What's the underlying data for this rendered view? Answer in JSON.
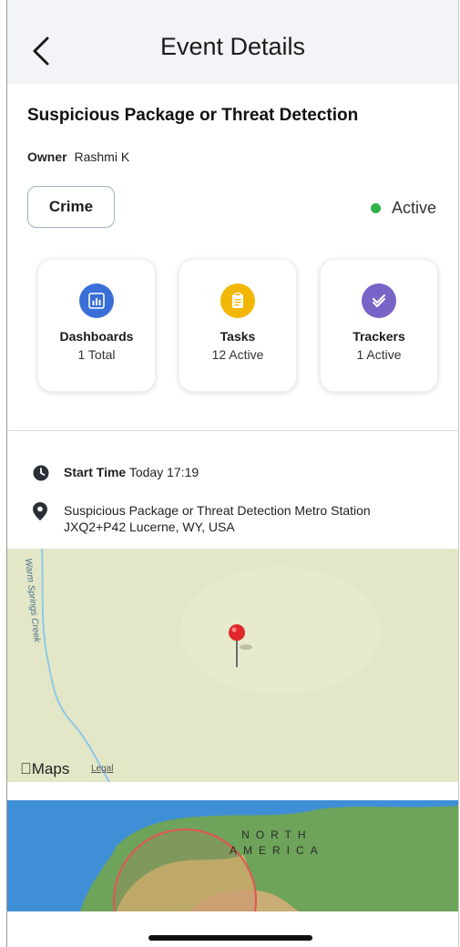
{
  "header": {
    "title": "Event Details",
    "back_icon": "chevron-left-icon"
  },
  "event": {
    "title": "Suspicious Package or Threat Detection",
    "owner_label": "Owner",
    "owner_name": "Rashmi K",
    "category": "Crime",
    "status": "Active",
    "status_color": "#2fb24a"
  },
  "cards": [
    {
      "label": "Dashboards",
      "value": "1 Total",
      "icon": "chart-icon",
      "color": "#3a6fd8"
    },
    {
      "label": "Tasks",
      "value": "12 Active",
      "icon": "clipboard-icon",
      "color": "#f2b705"
    },
    {
      "label": "Trackers",
      "value": "1 Active",
      "icon": "check-shield-icon",
      "color": "#7a63c7"
    }
  ],
  "details": {
    "start_label": "Start Time",
    "start_value": "Today 17:19",
    "location_line1": "Suspicious Package or Threat Detection Metro Station",
    "location_line2": "JXQ2+P42 Lucerne, WY, USA"
  },
  "map": {
    "creek_label": "Warm Springs Creek",
    "maps_logo": "Maps",
    "legal": "Legal",
    "region_line1": "NORTH",
    "region_line2": "AMERICA"
  }
}
